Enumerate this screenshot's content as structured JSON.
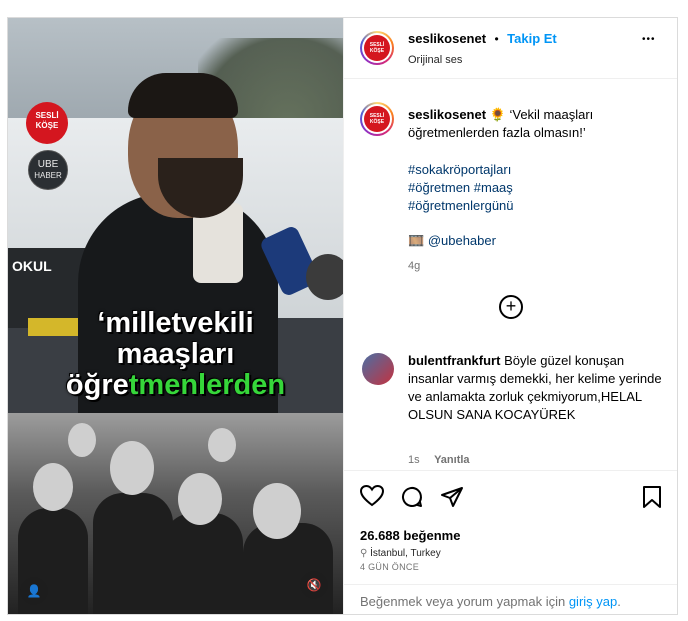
{
  "media": {
    "brand1": [
      "SESLİ",
      "KÖŞE"
    ],
    "brand2": [
      "UBE",
      "HABER"
    ],
    "bus_text": "OKUL",
    "caption_line1": "‘milletvekili",
    "caption_line2": "maaşları",
    "caption_line3_a": "öğre",
    "caption_line3_b": "tmenlerden",
    "mute_icon": "🔇",
    "user_icon": "👤"
  },
  "header": {
    "avatar_text": [
      "SESLİ",
      "KÖŞE"
    ],
    "username": "seslikosenet",
    "dot": "•",
    "follow": "Takip Et",
    "subtitle": "Orijinal ses",
    "more": "•••"
  },
  "post": {
    "username": "seslikosenet",
    "emoji": "🌻",
    "caption": "‘Vekil maaşları öğretmenlerden fazla olmasın!’",
    "tags": [
      "#sokakröportajları",
      "#öğretmen #maaş",
      "#öğretmenlergünü"
    ],
    "film_emoji": "🎞️",
    "mention": "@ubehaber",
    "time": "4g",
    "add_icon": "⊕"
  },
  "comment": {
    "username": "bulentfrankfurt",
    "text": "Böyle güzel konuşan insanlar varmış demekki, her kelime yerinde ve anlamakta zorluk çekmiyorum,HELAL OLSUN SANA KOCAYÜREK",
    "time": "1s",
    "reply": "Yanıtla"
  },
  "actions": {
    "likes": "26.688 beğenme",
    "location": "İstanbul, Turkey",
    "date": "4 GÜN ÖNCE"
  },
  "footer": {
    "text_a": "Beğenmek veya yorum yapmak için",
    "link": "giriş yap",
    "text_b": "."
  }
}
